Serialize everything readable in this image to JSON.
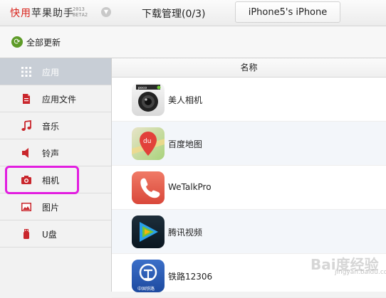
{
  "topbar": {
    "brand_red": "快用",
    "brand_rest": "苹果助手",
    "brand_year": "2013",
    "brand_edition": "BETA2",
    "downloads_tab": "下载管理(0/3)",
    "device_tab": "iPhone5's iPhone"
  },
  "toolbar": {
    "update_all": "全部更新",
    "update_icon": "refresh-icon"
  },
  "sidebar": {
    "items": [
      {
        "label": "应用",
        "icon": "grid-icon",
        "active": true
      },
      {
        "label": "应用文件",
        "icon": "document-icon",
        "active": false
      },
      {
        "label": "音乐",
        "icon": "music-note-icon",
        "active": false
      },
      {
        "label": "铃声",
        "icon": "speaker-icon",
        "active": false
      },
      {
        "label": "相机",
        "icon": "camera-icon",
        "active": false,
        "highlighted": true
      },
      {
        "label": "图片",
        "icon": "image-icon",
        "active": false
      },
      {
        "label": "U盘",
        "icon": "usb-drive-icon",
        "active": false
      }
    ]
  },
  "main": {
    "column_header": "名称",
    "apps": [
      {
        "name": "美人相机",
        "icon": "poco-camera-icon",
        "icon_text": "poco"
      },
      {
        "name": "百度地图",
        "icon": "baidu-map-icon",
        "icon_text": "du"
      },
      {
        "name": "WeTalkPro",
        "icon": "phone-handset-icon"
      },
      {
        "name": "腾讯视频",
        "icon": "tencent-video-icon"
      },
      {
        "name": "铁路12306",
        "icon": "railway-icon",
        "icon_text": "中国铁路"
      }
    ]
  },
  "watermark": {
    "text": "Bai度经验",
    "sub": "jingyan.baidu.com"
  },
  "colors": {
    "brand_red": "#d9241c",
    "accent_red": "#c9262c",
    "highlight": "#e21ee0",
    "active_row": "#c8ced6"
  }
}
